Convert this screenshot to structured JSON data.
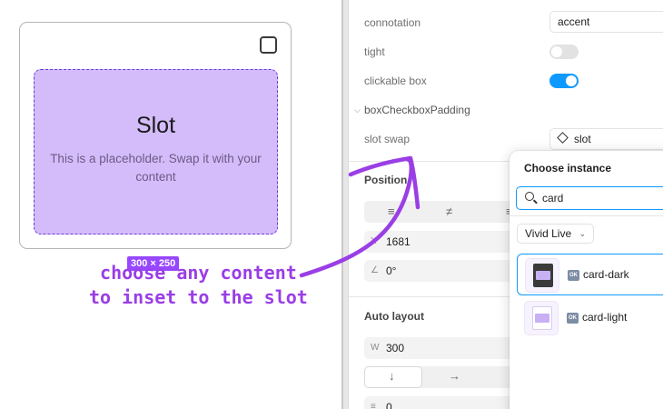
{
  "canvas": {
    "slot_title": "Slot",
    "slot_description": "This is a placeholder. Swap it with your content",
    "size_badge": "300 × 250",
    "annotation_line1": "choose any content",
    "annotation_line2": "to inset to the slot",
    "colors": {
      "slot_fill": "#d4bcfb",
      "slot_border": "#6c3ad8",
      "badge": "#9747ff",
      "annotation": "#9a3ee6"
    }
  },
  "properties": {
    "connotation_label": "connotation",
    "connotation_value": "accent",
    "tight_label": "tight",
    "tight_on": false,
    "clickable_box_label": "clickable box",
    "clickable_box_on": true,
    "group_title": "boxCheckboxPadding",
    "slot_swap_label": "slot swap",
    "slot_swap_value": "slot"
  },
  "position": {
    "title": "Position",
    "x_prefix": "X",
    "x_value": "1681",
    "rotation_value": "0°"
  },
  "auto_layout": {
    "title": "Auto layout",
    "width_prefix": "W",
    "width_value": "300",
    "gap_value": "0"
  },
  "choose_instance": {
    "title": "Choose instance",
    "search_value": "card",
    "library": "Vivid Live",
    "items": [
      {
        "name": "card-dark",
        "selected": true
      },
      {
        "name": "card-light",
        "selected": false
      }
    ]
  }
}
